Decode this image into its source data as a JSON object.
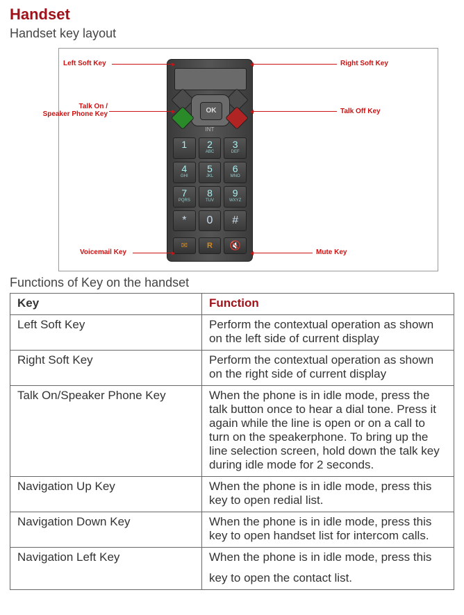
{
  "heading": "Handset",
  "subheading": "Handset key layout",
  "diagram": {
    "labels": {
      "left_soft": "Left Soft Key",
      "right_soft": "Right Soft Key",
      "talk_on": "Talk On /\nSpeaker Phone Key",
      "talk_off": "Talk Off Key",
      "voicemail": "Voicemail Key",
      "mute": "Mute Key"
    },
    "ok": "OK",
    "int": "INT",
    "keys": [
      {
        "n": "1",
        "s": ""
      },
      {
        "n": "2",
        "s": "ABC"
      },
      {
        "n": "3",
        "s": "DEF"
      },
      {
        "n": "4",
        "s": "GHI"
      },
      {
        "n": "5",
        "s": "JKL"
      },
      {
        "n": "6",
        "s": "MNO"
      },
      {
        "n": "7",
        "s": "PQRS"
      },
      {
        "n": "8",
        "s": "TUV"
      },
      {
        "n": "9",
        "s": "WXYZ"
      },
      {
        "n": "*",
        "s": ""
      },
      {
        "n": "0",
        "s": ""
      },
      {
        "n": "#",
        "s": ""
      }
    ],
    "bottom": {
      "r": "R"
    }
  },
  "table_caption": "Functions of Key on the handset",
  "table": {
    "head": {
      "key": "Key",
      "func": "Function"
    },
    "rows": [
      {
        "key": "Left Soft Key",
        "func": "Perform the contextual operation as shown on the left side of current display"
      },
      {
        "key": "Right Soft Key",
        "func": "Perform the contextual operation as shown on the right side of current display"
      },
      {
        "key": "Talk On/Speaker Phone Key",
        "func": "When the phone is in idle mode, press the talk button once to hear a dial tone. Press it again while the line is open or on a call to turn on the speakerphone.  To bring up the line selection screen,  hold down the talk key during idle mode for 2 seconds."
      },
      {
        "key": "Navigation Up Key",
        "func": "When the phone is in idle mode, press this key to open redial list."
      },
      {
        "key": "Navigation Down Key",
        "func": "When the phone is in idle mode, press this key to open handset list for intercom calls."
      },
      {
        "key": "Navigation Left Key",
        "func": "When the phone is in idle mode, press this"
      },
      {
        "key": "",
        "func": "key to open the contact list."
      }
    ]
  }
}
